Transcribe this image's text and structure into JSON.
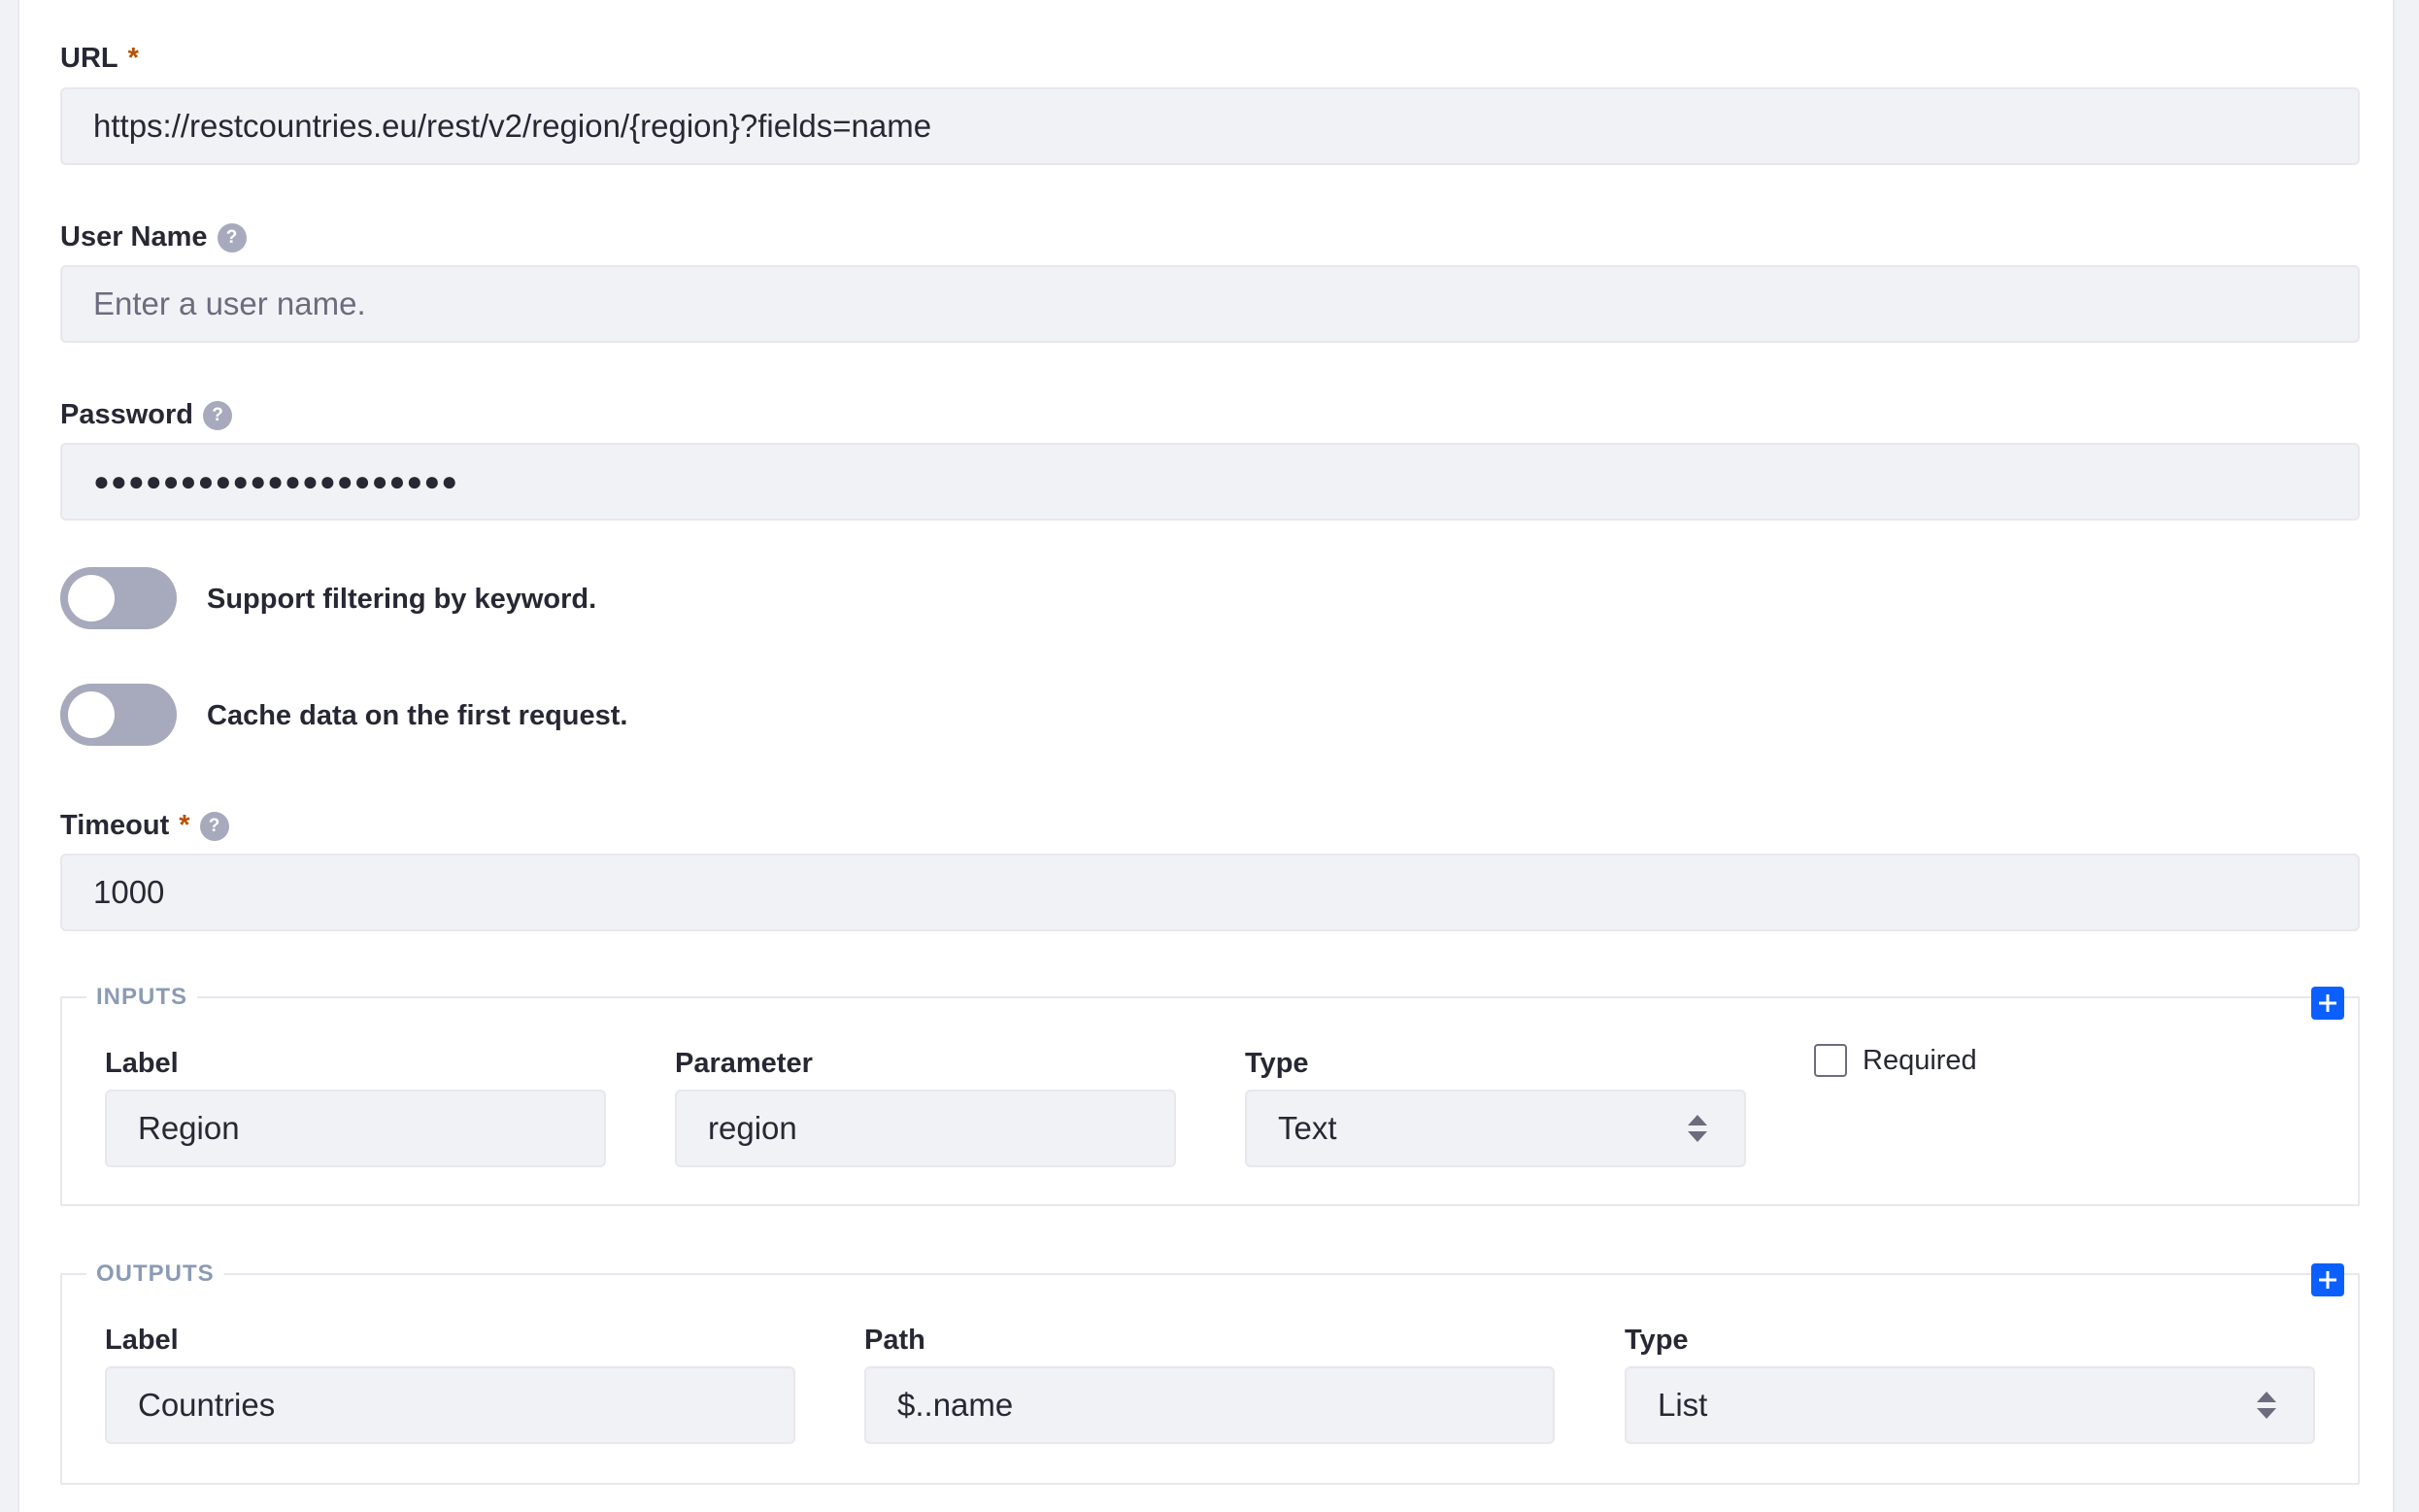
{
  "url": {
    "label": "URL",
    "required_mark": "*",
    "value": "https://restcountries.eu/rest/v2/region/{region}?fields=name"
  },
  "username": {
    "label": "User Name",
    "help": "?",
    "placeholder": "Enter a user name."
  },
  "password": {
    "label": "Password",
    "help": "?",
    "masked_value": "●●●●●●●●●●●●●●●●●●●●●"
  },
  "toggles": {
    "filter_label": "Support filtering by keyword.",
    "filter_on": false,
    "cache_label": "Cache data on the first request.",
    "cache_on": false
  },
  "timeout": {
    "label": "Timeout",
    "required_mark": "*",
    "help": "?",
    "value": "1000"
  },
  "inputs": {
    "legend": "INPUTS",
    "label_header": "Label",
    "parameter_header": "Parameter",
    "type_header": "Type",
    "required_label": "Required",
    "required_checked": false,
    "row": {
      "label": "Region",
      "parameter": "region",
      "type": "Text"
    }
  },
  "outputs": {
    "legend": "OUTPUTS",
    "label_header": "Label",
    "path_header": "Path",
    "type_header": "Type",
    "row": {
      "label": "Countries",
      "path": "$..name",
      "type": "List"
    }
  },
  "icons": {
    "add_icon": "plus-icon",
    "help_icon": "question-circle-icon",
    "select_icon": "caret-double-icon"
  },
  "colors": {
    "accent": "#0b5fff",
    "required": "#b95000",
    "toggle_off": "#a7a9bc",
    "field_bg": "#f1f2f5",
    "legend": "#8b9bb4"
  }
}
